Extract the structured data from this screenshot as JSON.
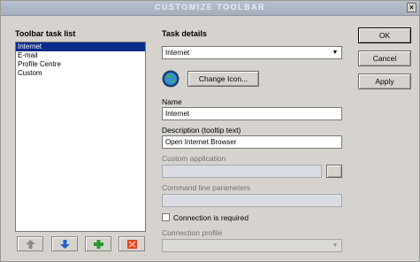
{
  "window": {
    "title": "Customize Toolbar",
    "close_glyph": "×"
  },
  "left_panel": {
    "heading": "Toolbar task list",
    "items": [
      "Internet",
      "E-mail",
      "Profile Centre",
      "Custom"
    ],
    "selected_index": 0
  },
  "toolbar_buttons": [
    {
      "icon": "up-arrow-icon",
      "color": "#8c8a86"
    },
    {
      "icon": "down-arrow-icon",
      "color": "#1f5fd0"
    },
    {
      "icon": "add-plus-icon",
      "color": "#2a9a2a"
    },
    {
      "icon": "delete-x-icon",
      "color": "#e0441a"
    }
  ],
  "details": {
    "heading": "Task details",
    "task_select": "Internet",
    "change_icon_label": "Change Icon...",
    "name_label": "Name",
    "name_value": "Internet",
    "description_label": "Description (tooltip text)",
    "description_value": "Open Internet Browser",
    "custom_app_label": "Custom application",
    "custom_app_value": "",
    "cmdline_label": "Command line parameters",
    "cmdline_value": "",
    "connection_checkbox_label": "Connection is required",
    "connection_required": false,
    "connection_profile_label": "Connection profile",
    "connection_profile_value": ""
  },
  "actions": {
    "ok": "OK",
    "cancel": "Cancel",
    "apply": "Apply"
  },
  "colors": {
    "selection": "#0b2a8a",
    "titlebar": "#a5aebd",
    "dialog_bg": "#d6d3ce"
  }
}
